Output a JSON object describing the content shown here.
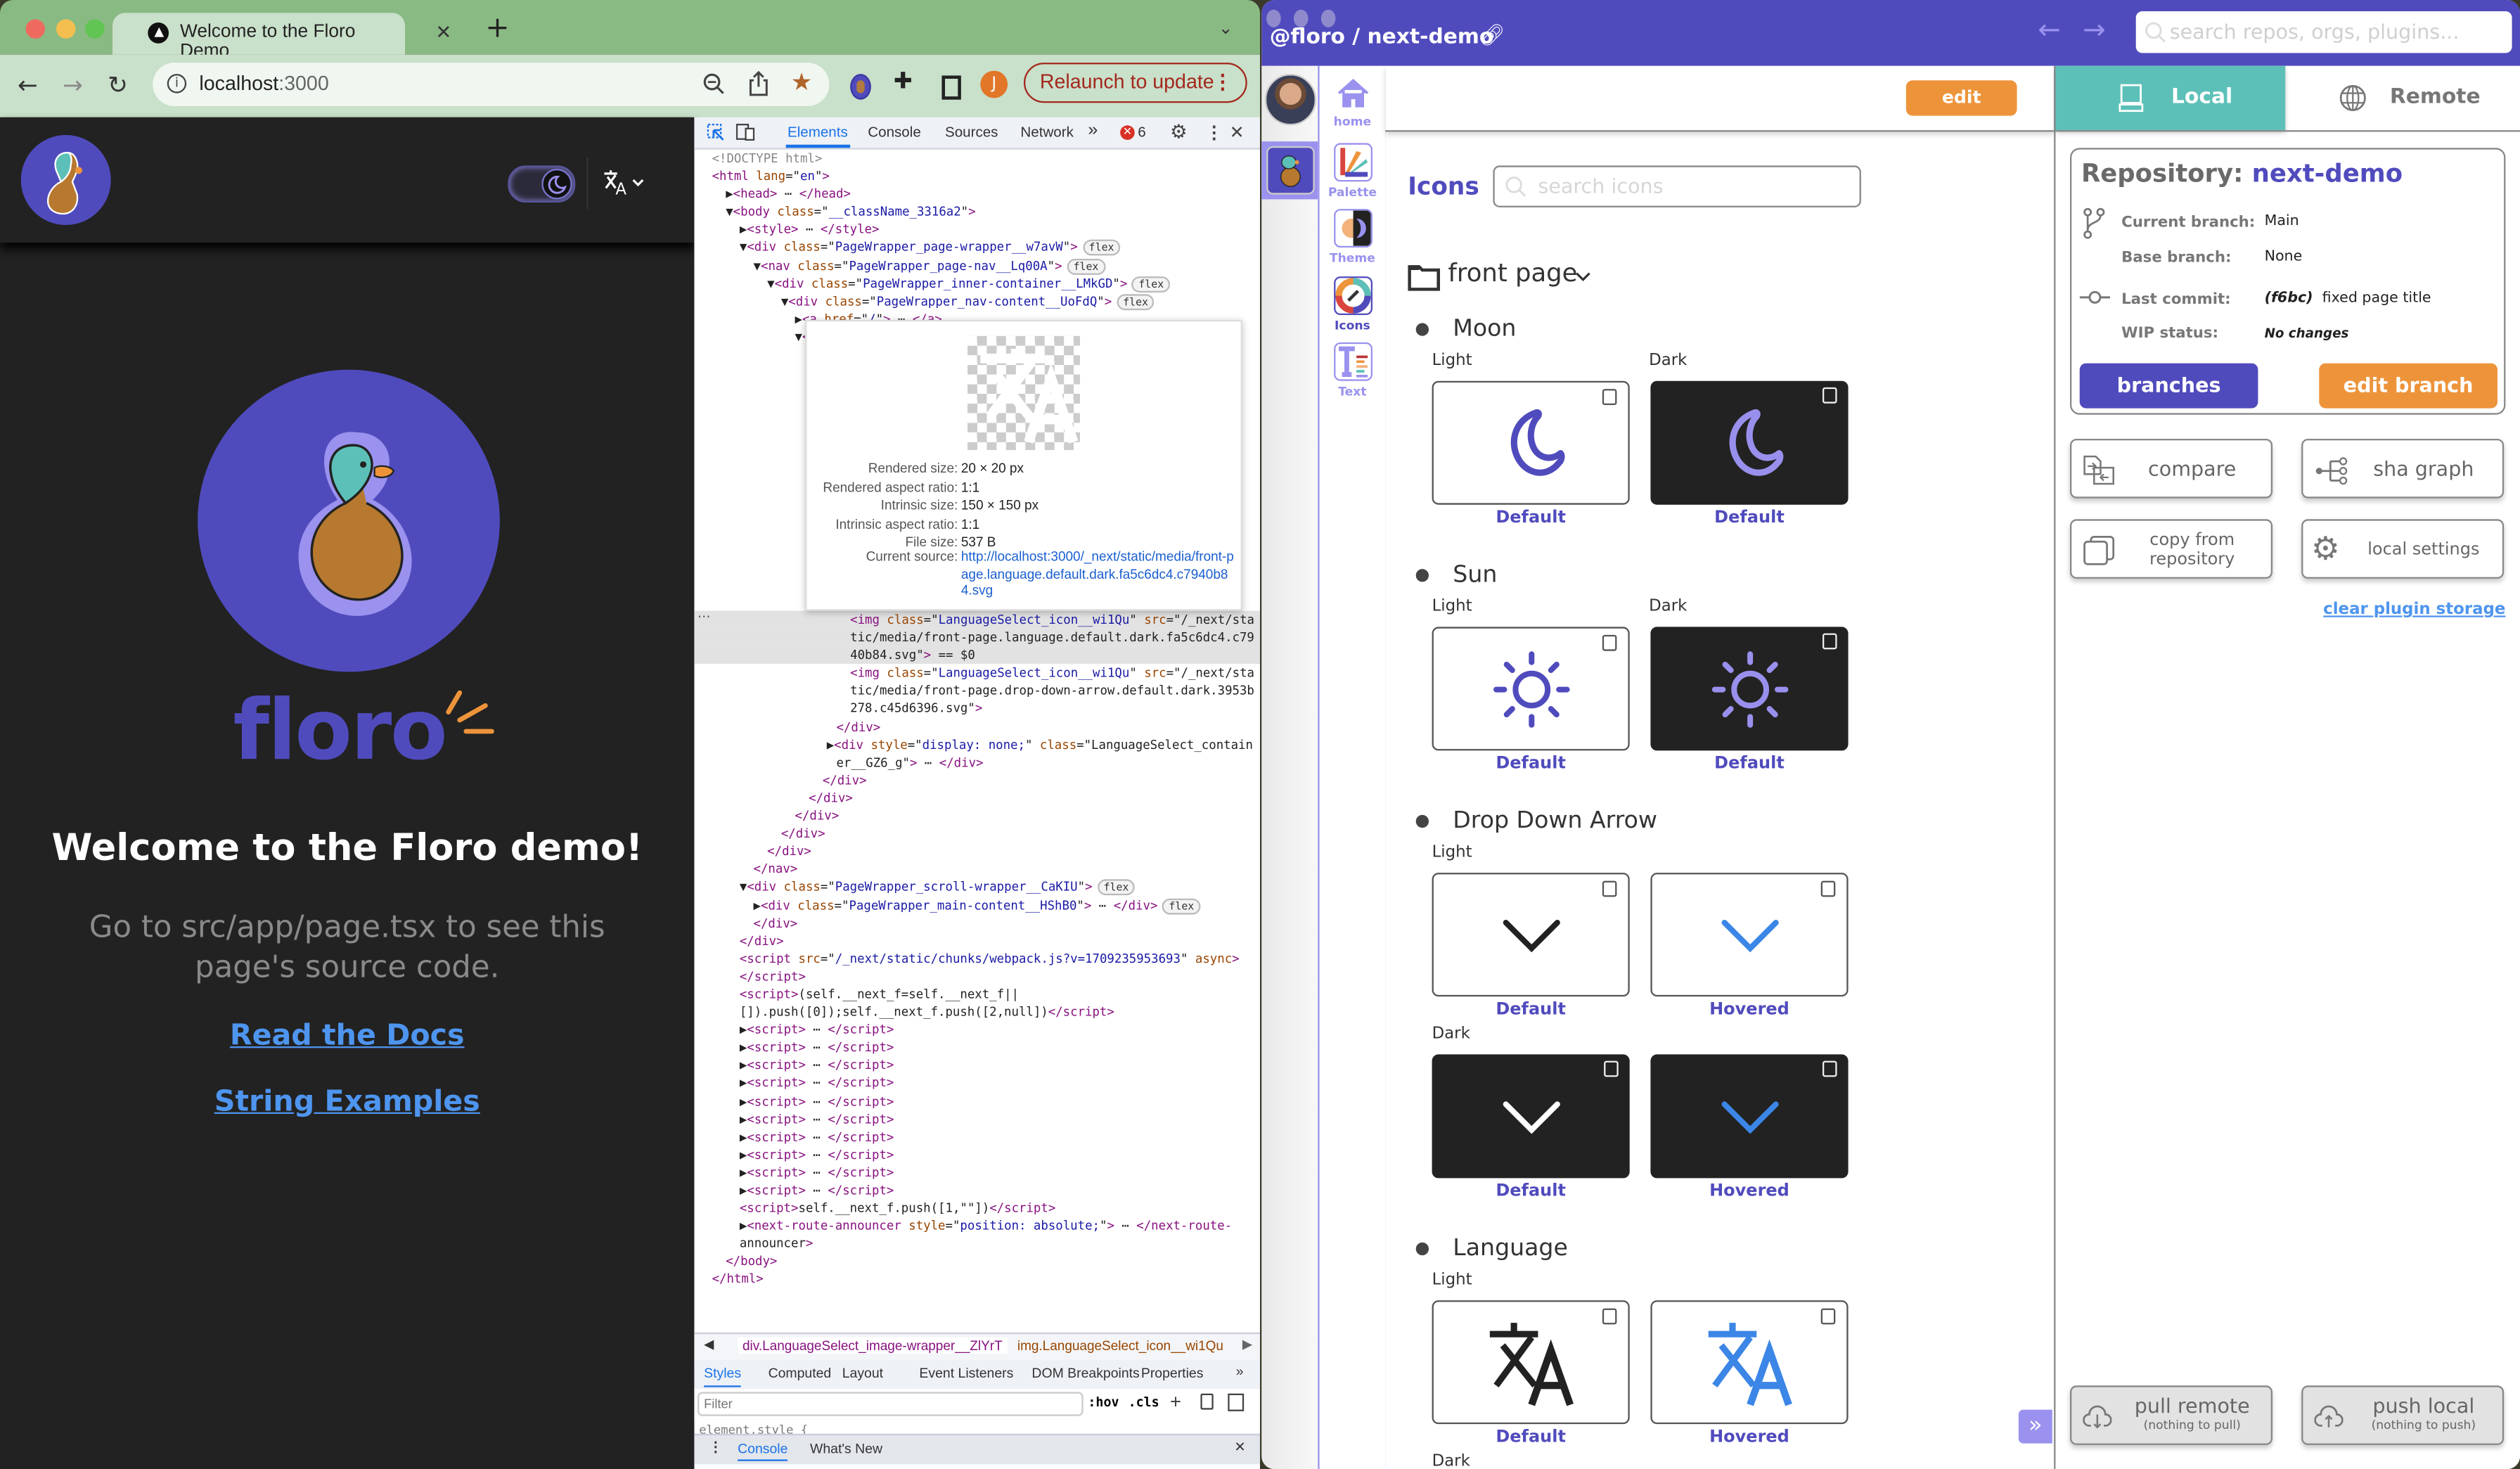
{
  "browser": {
    "tab_title": "Welcome to the Floro Demo",
    "url_host": "localhost",
    "url_port": ":3000",
    "profile_initial": "J",
    "relaunch_label": "Relaunch to update",
    "colors": {
      "tabbar": "#8aba84",
      "toolbar": "#c9e0ca"
    }
  },
  "page": {
    "heading": "Welcome to the Floro demo!",
    "subtext": "Go to src/app/page.tsx to see this page's source code.",
    "brand_text": "floro",
    "links": [
      "Read the Docs",
      "String Examples"
    ],
    "theme_toggle": "dark",
    "colors": {
      "background": "#222222",
      "brand": "#504bbd",
      "link": "#4e95ef"
    }
  },
  "devtools": {
    "tabs": [
      "Elements",
      "Console",
      "Sources",
      "Network"
    ],
    "active_tab": "Elements",
    "more": "»",
    "error_count": "6",
    "lines": [
      {
        "d": 0,
        "t": "<!DOCTYPE html>"
      },
      {
        "d": 0,
        "t": "<html lang=\"en\">"
      },
      {
        "d": 1,
        "t": "▶<head> ⋯ </head>"
      },
      {
        "d": 1,
        "t": "▼<body class=\"__className_3316a2\">"
      },
      {
        "d": 2,
        "t": "▶<style> ⋯ </style>"
      },
      {
        "d": 2,
        "t": "▼<div class=\"PageWrapper_page-wrapper__w7avW\">",
        "flex": true
      },
      {
        "d": 3,
        "t": "▼<nav class=\"PageWrapper_page-nav__Lq00A\">",
        "flex": true
      },
      {
        "d": 4,
        "t": "▼<div class=\"PageWrapper_inner-container__LMkGD\">",
        "flex": true
      },
      {
        "d": 5,
        "t": "▼<div class=\"PageWrapper_nav-content__UoFdQ\">",
        "flex": true
      },
      {
        "d": 6,
        "t": "▶<a href=\"/\"> ⋯ </a>"
      },
      {
        "d": 6,
        "t": "▼<d"
      }
    ],
    "lines_after": [
      {
        "d": 10,
        "t": "<img class=\"LanguageSelect_icon__wi1Qu\" src=\"/_next/sta",
        "sel": true
      },
      {
        "d": 10,
        "t": "tic/media/front-page.language.default.dark.fa5c6dc4.c79",
        "sel": true
      },
      {
        "d": 10,
        "t": "40b84.svg\"> == $0",
        "sel": true
      },
      {
        "d": 10,
        "t": "<img class=\"LanguageSelect_icon__wi1Qu\" src=\"/_next/sta"
      },
      {
        "d": 10,
        "t": "tic/media/front-page.drop-down-arrow.default.dark.3953b"
      },
      {
        "d": 10,
        "t": "278.c45d6396.svg\">"
      },
      {
        "d": 9,
        "t": "</div>"
      },
      {
        "d": 8.3,
        "t": "▶<div style=\"display: none;\" class=\"LanguageSelect_contain"
      },
      {
        "d": 9,
        "t": "er__GZ6_g\"> ⋯ </div>"
      },
      {
        "d": 8,
        "t": "</div>"
      },
      {
        "d": 7,
        "t": "</div>"
      },
      {
        "d": 6,
        "t": "</div>"
      },
      {
        "d": 5,
        "t": "</div>"
      },
      {
        "d": 4,
        "t": "</div>"
      },
      {
        "d": 3,
        "t": "</nav>"
      },
      {
        "d": 2,
        "t": "▼<div class=\"PageWrapper_scroll-wrapper__CaKIU\">",
        "flex": true
      },
      {
        "d": 3,
        "t": "▶<div class=\"PageWrapper_main-content__HShB0\"> ⋯ </div>",
        "flex": true
      },
      {
        "d": 3,
        "t": "</div>"
      },
      {
        "d": 2,
        "t": "</div>"
      },
      {
        "d": 2,
        "t": "<script src=\"/_next/static/chunks/webpack.js?v=1709235953693\" async>"
      },
      {
        "d": 2,
        "t": "</script>"
      },
      {
        "d": 2,
        "t": "<script>(self.__next_f=self.__next_f||"
      },
      {
        "d": 2,
        "t": "[]).push([0]);self.__next_f.push([2,null])</script>"
      },
      {
        "d": 2,
        "t": "▶<script> ⋯ </script>"
      },
      {
        "d": 2,
        "t": "▶<script> ⋯ </script>"
      },
      {
        "d": 2,
        "t": "▶<script> ⋯ </script>"
      },
      {
        "d": 2,
        "t": "▶<script> ⋯ </script>"
      },
      {
        "d": 2,
        "t": "▶<script> ⋯ </script>"
      },
      {
        "d": 2,
        "t": "▶<script> ⋯ </script>"
      },
      {
        "d": 2,
        "t": "▶<script> ⋯ </script>"
      },
      {
        "d": 2,
        "t": "▶<script> ⋯ </script>"
      },
      {
        "d": 2,
        "t": "▶<script> ⋯ </script>"
      },
      {
        "d": 2,
        "t": "▶<script> ⋯ </script>"
      },
      {
        "d": 2,
        "t": "<script>self.__next_f.push([1,\"\"])</script>"
      },
      {
        "d": 2,
        "t": "▶<next-route-announcer style=\"position: absolute;\"> ⋯ </next-route-"
      },
      {
        "d": 2,
        "t": "announcer>"
      },
      {
        "d": 1,
        "t": "</body>"
      },
      {
        "d": 0,
        "t": "</html>"
      }
    ],
    "flex_badge": "flex",
    "tooltip": {
      "rows": [
        {
          "k": "Rendered size:",
          "v": "20 × 20 px"
        },
        {
          "k": "Rendered aspect ratio:",
          "v": "1:1"
        },
        {
          "k": "Intrinsic size:",
          "v": "150 × 150 px"
        },
        {
          "k": "Intrinsic aspect ratio:",
          "v": "1:1"
        },
        {
          "k": "File size:",
          "v": "537 B"
        }
      ],
      "source_label": "Current source:",
      "source_url": "http://localhost:3000/_next/static/media/front-page.language.default.dark.fa5c6dc4.c7940b84.svg"
    },
    "breadcrumbs": [
      "div.LanguageSelect_image-wrapper__ZlYrT",
      "img.LanguageSelect_icon__wi1Qu"
    ],
    "style_tabs": [
      "Styles",
      "Computed",
      "Layout",
      "Event Listeners",
      "DOM Breakpoints",
      "Properties"
    ],
    "filter_placeholder": "Filter",
    "hov": ":hov",
    "cls": ".cls",
    "element_style": "element.style {",
    "drawer_tabs": [
      "Console",
      "What's New"
    ]
  },
  "floro": {
    "title": "@floro / next-demo",
    "search_placeholder": "search repos, orgs, plugins...",
    "rail": [
      {
        "label": "home",
        "icon": "home-icon"
      },
      {
        "label": "Palette",
        "icon": "palette-icon"
      },
      {
        "label": "Theme",
        "icon": "theme-icon"
      },
      {
        "label": "Icons",
        "icon": "icons-plugin-icon",
        "active": true
      },
      {
        "label": "Text",
        "icon": "text-icon"
      }
    ],
    "edit_label": "edit",
    "plugin_title": "Icons",
    "icon_search_placeholder": "search icons",
    "group": "front page",
    "icons": [
      {
        "name": "Moon",
        "glyph": "moon",
        "rows": [
          {
            "labels": [
              "Light",
              "Dark"
            ],
            "cards": [
              {
                "theme": "light",
                "color": "#504bbd",
                "caption": "Default"
              },
              {
                "theme": "dark",
                "color": "#9990ed",
                "caption": "Default"
              }
            ]
          }
        ]
      },
      {
        "name": "Sun",
        "glyph": "sun",
        "rows": [
          {
            "labels": [
              "Light",
              "Dark"
            ],
            "cards": [
              {
                "theme": "light",
                "color": "#504bbd",
                "caption": "Default"
              },
              {
                "theme": "dark",
                "color": "#9990ed",
                "caption": "Default"
              }
            ]
          }
        ]
      },
      {
        "name": "Drop Down Arrow",
        "glyph": "chevron",
        "rows": [
          {
            "labels": [
              "Light"
            ],
            "cards": [
              {
                "theme": "light",
                "color": "#222222",
                "caption": "Default"
              },
              {
                "theme": "light",
                "color": "#3b86e6",
                "caption": "Hovered"
              }
            ]
          },
          {
            "labels": [
              "Dark"
            ],
            "cards": [
              {
                "theme": "dark",
                "color": "#ffffff",
                "caption": "Default"
              },
              {
                "theme": "dark",
                "color": "#3b86e6",
                "caption": "Hovered"
              }
            ]
          }
        ]
      },
      {
        "name": "Language",
        "glyph": "language",
        "rows": [
          {
            "labels": [
              "Light"
            ],
            "cards": [
              {
                "theme": "light",
                "color": "#222222",
                "caption": "Default"
              },
              {
                "theme": "light",
                "color": "#3b86e6",
                "caption": "Hovered"
              }
            ]
          },
          {
            "labels": [
              "Dark"
            ],
            "cards": []
          }
        ]
      }
    ],
    "tabs": {
      "local": "Local",
      "remote": "Remote",
      "active": "local"
    },
    "repo": {
      "label": "Repository:",
      "name": "next-demo",
      "current_branch_label": "Current branch:",
      "current_branch": "Main",
      "base_branch_label": "Base branch:",
      "base_branch": "None",
      "last_commit_label": "Last commit:",
      "last_commit_sha": "(f6bc)",
      "last_commit_msg": "fixed page title",
      "wip_label": "WIP status:",
      "wip": "No changes",
      "branches_btn": "branches",
      "edit_branch_btn": "edit branch"
    },
    "actions": {
      "compare": "compare",
      "sha_graph": "sha graph",
      "copy_from": "copy from repository",
      "local_settings": "local settings"
    },
    "clear_storage": "clear plugin storage",
    "pull": {
      "label": "pull remote",
      "sub": "(nothing to pull)"
    },
    "push": {
      "label": "push local",
      "sub": "(nothing to push)"
    },
    "colors": {
      "primary": "#504bbd",
      "secondary": "#9a92ee",
      "orange": "#ed943b",
      "teal": "#5dc0b8"
    }
  }
}
